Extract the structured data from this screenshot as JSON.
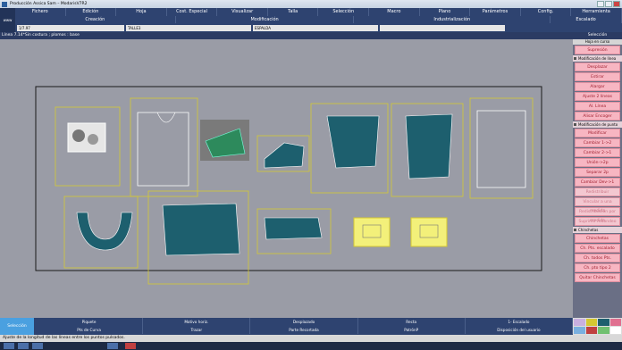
{
  "window": {
    "title": "Producción Assica Sam – ModarisV7R2"
  },
  "menubar": {
    "left_label": "www",
    "menus": [
      "Fichero",
      "Edición",
      "Hoja",
      "Cost. Especial",
      "Visualizar",
      "Talla",
      "Selección",
      "Macro",
      "Plano",
      "Parámetros",
      "Config.",
      "Herramienta"
    ],
    "modes": [
      "Creación",
      "Modificación",
      "Industrialización",
      "Escalado"
    ],
    "fields": {
      "scale": "1/7.97",
      "size": "TALLE3",
      "model": "ESPALDA"
    }
  },
  "info_bar": "Línea 7.14*Sin costura  ;  plomos : base",
  "side_panel": {
    "title": "Selección",
    "subtitle": "Hoja en curso",
    "sections": [
      {
        "type": "button",
        "label": "Supresión",
        "disabled": false
      },
      {
        "type": "section",
        "label": "Modificación de línea"
      },
      {
        "type": "button",
        "label": "Desplazar",
        "disabled": false
      },
      {
        "type": "button",
        "label": "Estirar",
        "disabled": false
      },
      {
        "type": "button",
        "label": "Alargar",
        "disabled": false
      },
      {
        "type": "button",
        "label": "Ajuste 2 líneas",
        "disabled": false
      },
      {
        "type": "button",
        "label": "Al. Línea",
        "disabled": false
      },
      {
        "type": "button",
        "label": "Alisar  Encoger",
        "disabled": false
      },
      {
        "type": "section",
        "label": "Modificación de punto"
      },
      {
        "type": "button",
        "label": "Modificar",
        "disabled": false
      },
      {
        "type": "button",
        "label": "Cambiar 1->2",
        "disabled": false
      },
      {
        "type": "button",
        "label": "Cambiar 2->1",
        "disabled": false
      },
      {
        "type": "button",
        "label": "Unión->2p",
        "disabled": false
      },
      {
        "type": "button",
        "label": "Separar 2p",
        "disabled": false
      },
      {
        "type": "button",
        "label": "Cambiar Dev->1",
        "disabled": false
      },
      {
        "type": "button",
        "label": "Redistribuir",
        "disabled": true
      },
      {
        "type": "button",
        "label": "Vincular a una medida",
        "disabled": true
      },
      {
        "type": "button",
        "label": "Redistribución por medida",
        "disabled": true
      },
      {
        "type": "button",
        "label": "Suprimir redondeo",
        "disabled": true
      },
      {
        "type": "section",
        "label": "Chinchetas"
      },
      {
        "type": "button",
        "label": "Chinchetas",
        "disabled": false
      },
      {
        "type": "button",
        "label": "Ch. Pts. escalado",
        "disabled": false
      },
      {
        "type": "button",
        "label": "Ch. todos Pts.",
        "disabled": false
      },
      {
        "type": "button",
        "label": "Ch. pto tipo 2",
        "disabled": false
      },
      {
        "type": "button",
        "label": "Quitar Chinchetas",
        "disabled": false
      }
    ]
  },
  "bottom_bar": {
    "selection_button": "Selección",
    "row1": [
      "Piquete",
      "Motivo horiz.",
      "Desplazado",
      "Recta",
      "1- Escalado"
    ],
    "row2": [
      "Pts de Curva",
      "Trazar",
      "Parte Recortada",
      "PatrónP",
      "Disposición del usuario"
    ]
  },
  "status_bar": "Ajuste de la longitud de las líneas entre los puntos pulsados.",
  "colors": {
    "panel_button": "#f7b6c2",
    "piece_fill": "#1d5f6e",
    "menu_bg": "#2e4370"
  }
}
